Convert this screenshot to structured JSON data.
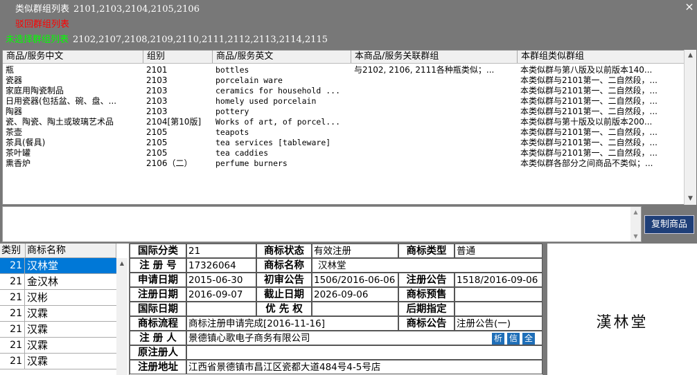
{
  "groups": {
    "similar": {
      "label": "类似群组列表",
      "value": "2101,2103,2104,2105,2106",
      "color": "#ffffff"
    },
    "rejected": {
      "label": "驳回群组列表",
      "value": "",
      "color": "#ff0000"
    },
    "unselected": {
      "label": "未选择群组列表",
      "value": "2102,2107,2108,2109,2110,2111,2112,2113,2114,2115",
      "color": "#00ff00"
    }
  },
  "window": {
    "close_glyph": "×"
  },
  "grid": {
    "columns": [
      "商品/服务中文",
      "组别",
      "商品/服务英文",
      "本商品/服务关联群组",
      "本群组类似群组"
    ],
    "rows": [
      {
        "cn": "瓶",
        "group": "2101",
        "en": "bottles",
        "related": "与2102, 2106, 2111各种瓶类似；...",
        "similar": "本类似群与第八版及以前版本140..."
      },
      {
        "cn": "瓷器",
        "group": "2103",
        "en": "porcelain ware",
        "related": "",
        "similar": "本类似群与2101第一、二自然段，..."
      },
      {
        "cn": "家庭用陶瓷制品",
        "group": "2103",
        "en": "ceramics for household ...",
        "related": "",
        "similar": "本类似群与2101第一、二自然段，..."
      },
      {
        "cn": "日用瓷器(包括盆、碗、盘、...",
        "group": "2103",
        "en": "homely used porcelain",
        "related": "",
        "similar": "本类似群与2101第一、二自然段，..."
      },
      {
        "cn": "陶器",
        "group": "2103",
        "en": "pottery",
        "related": "",
        "similar": "本类似群与2101第一、二自然段，..."
      },
      {
        "cn": "瓷、陶瓷、陶土或玻璃艺术品",
        "group": "2104[第10版]",
        "en": "Works of art, of porcel...",
        "related": "",
        "similar": "本类似群与第十版及以前版本200..."
      },
      {
        "cn": "茶壶",
        "group": "2105",
        "en": "teapots",
        "related": "",
        "similar": "本类似群与2101第一、二自然段，..."
      },
      {
        "cn": "茶具(餐具)",
        "group": "2105",
        "en": "tea services [tableware]",
        "related": "",
        "similar": "本类似群与2101第一、二自然段，..."
      },
      {
        "cn": "茶叶罐",
        "group": "2105",
        "en": "tea caddies",
        "related": "",
        "similar": "本类似群与2101第一、二自然段，..."
      },
      {
        "cn": "熏香炉",
        "group": "2106（二）",
        "en": "perfume burners",
        "related": "",
        "similar": "本类似群各部分之间商品不类似；..."
      }
    ]
  },
  "copy_button": "复制商品",
  "list": {
    "headers": [
      "类别",
      "商标名称"
    ],
    "rows": [
      {
        "num": "21",
        "name": "汉林堂",
        "selected": true
      },
      {
        "num": "21",
        "name": "金汉林",
        "selected": false
      },
      {
        "num": "21",
        "name": "汉彬",
        "selected": false
      },
      {
        "num": "21",
        "name": "汉霖",
        "selected": false
      },
      {
        "num": "21",
        "name": "汉霖",
        "selected": false
      },
      {
        "num": "21",
        "name": "汉霖",
        "selected": false
      },
      {
        "num": "21",
        "name": "汉霖",
        "selected": false
      }
    ]
  },
  "detail": {
    "intl_class_label": "国际分类",
    "intl_class": "21",
    "status_label": "商标状态",
    "status": "有效注册",
    "type_label": "商标类型",
    "type": "普通",
    "reg_no_label": "注 册 号",
    "reg_no": "17326064",
    "name_label": "商标名称",
    "name": "汉林堂",
    "apply_date_label": "申请日期",
    "apply_date": "2015-06-30",
    "prelim_label": "初审公告",
    "prelim": "1506/2016-06-06",
    "reg_notice_label": "注册公告",
    "reg_notice": "1518/2016-09-06",
    "reg_date_label": "注册日期",
    "reg_date": "2016-09-07",
    "expire_label": "截止日期",
    "expire": "2026-09-06",
    "presale_label": "商标预售",
    "presale": "",
    "intl_date_label": "国际日期",
    "intl_date": "",
    "priority_label": "优 先 权",
    "priority": "",
    "later_label": "后期指定",
    "later": "",
    "flow_label": "商标流程",
    "flow": "商标注册申请完成[2016-11-16]",
    "notice_label": "商标公告",
    "notice": "注册公告(一)",
    "registrant_label": "注 册 人",
    "registrant": "景德镇心歌电子商务有限公司",
    "btn_analyze": "析",
    "btn_credit": "信",
    "btn_all": "全",
    "orig_registrant_label": "原注册人",
    "orig_registrant": "",
    "address_label": "注册地址",
    "address": "江西省景德镇市昌江区瓷都大道484号4-5号店"
  },
  "logo": {
    "text": "漢林堂"
  }
}
